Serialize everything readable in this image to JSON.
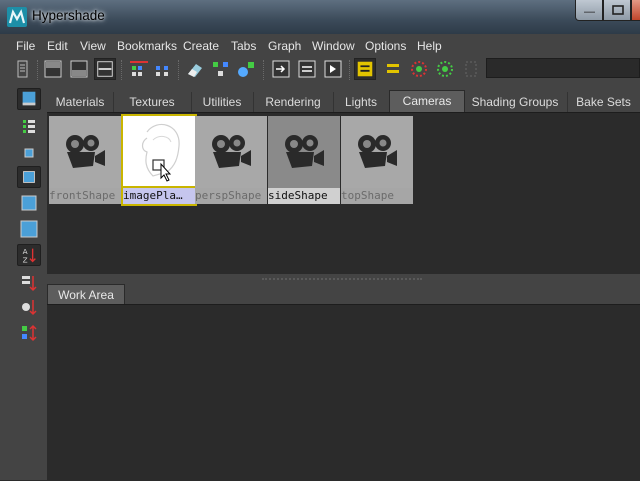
{
  "window": {
    "title": "Hypershade"
  },
  "menu": [
    "File",
    "Edit",
    "View",
    "Bookmarks",
    "Create",
    "Tabs",
    "Graph",
    "Window",
    "Options",
    "Help"
  ],
  "tabs": [
    {
      "label": "Materials",
      "selected": false
    },
    {
      "label": "Textures",
      "selected": false
    },
    {
      "label": "Utilities",
      "selected": false
    },
    {
      "label": "Rendering",
      "selected": false
    },
    {
      "label": "Lights",
      "selected": false
    },
    {
      "label": "Cameras",
      "selected": true
    },
    {
      "label": "Shading Groups",
      "selected": false
    },
    {
      "label": "Bake Sets",
      "selected": false
    }
  ],
  "swatches": [
    {
      "label": "frontShape",
      "icon": "movie-camera-icon",
      "state": "normal"
    },
    {
      "label": "imagePla…",
      "icon": "image-plane-icon",
      "state": "selected"
    },
    {
      "label": "perspShape",
      "icon": "movie-camera-icon",
      "state": "normal"
    },
    {
      "label": "sideShape",
      "icon": "movie-camera-icon",
      "state": "dim"
    },
    {
      "label": "topShape",
      "icon": "movie-camera-icon",
      "state": "normal"
    }
  ],
  "work_area": {
    "tab_label": "Work Area"
  },
  "colors": {
    "selection_outline": "#c9b500",
    "selected_label_bg": "#c6c6ee",
    "panel_bg": "#2b2b2b",
    "chrome_bg": "#444444"
  }
}
